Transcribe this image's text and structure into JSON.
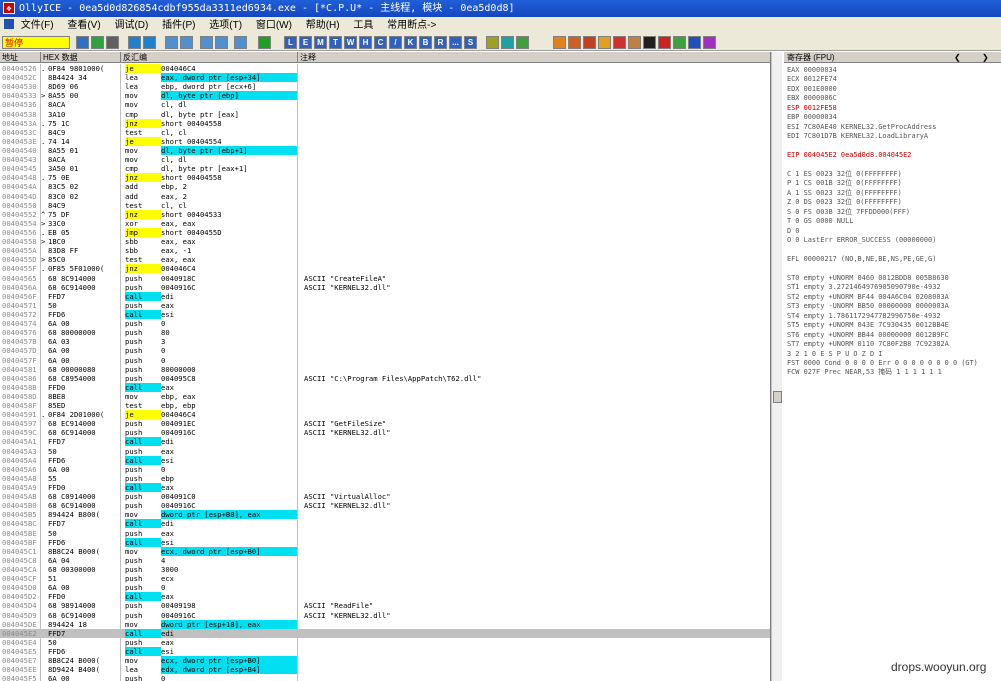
{
  "window": {
    "title": "OllyICE - 0ea5d0d826854cdbf955da3311ed6934.exe - [*C.P.U* - 主线程, 模块 - 0ea5d0d8]",
    "icon_glyph": "❖"
  },
  "menu": [
    "文件(F)",
    "查看(V)",
    "调试(D)",
    "插件(P)",
    "选项(T)",
    "窗口(W)",
    "帮助(H)",
    "工具",
    "常用断点->"
  ],
  "toolbar": {
    "status": "暂停",
    "letters": [
      "L",
      "E",
      "M",
      "T",
      "W",
      "H",
      "C",
      "/",
      "K",
      "B",
      "R",
      "...",
      "S"
    ]
  },
  "cpu": {
    "headers": {
      "address": "地址",
      "hex": "HEX 数据",
      "disasm": "反汇编",
      "comment": "注释"
    },
    "rows": [
      {
        "a": "00404526",
        "m": ".",
        "h": "0F84 9801000(",
        "mn": "je",
        "op": "004046C4",
        "cm": "",
        "mnc": "yel"
      },
      {
        "a": "0040452C",
        "m": "",
        "h": "8B4424 34",
        "mn": "lea",
        "op": "eax, dword ptr [esp+34]",
        "cm": "",
        "opc": "cyan"
      },
      {
        "a": "00404530",
        "m": "",
        "h": "8D69 06",
        "mn": "lea",
        "op": "ebp, dword ptr [ecx+6]",
        "cm": ""
      },
      {
        "a": "00404533",
        "m": ">",
        "h": "8A55 00",
        "mn": "mov",
        "op": "dl, byte ptr [ebp]",
        "cm": "",
        "opc": "cyan"
      },
      {
        "a": "00404536",
        "m": "",
        "h": "8ACA",
        "mn": "mov",
        "op": "cl, dl",
        "cm": ""
      },
      {
        "a": "00404538",
        "m": "",
        "h": "3A10",
        "mn": "cmp",
        "op": "dl, byte ptr [eax]",
        "cm": ""
      },
      {
        "a": "0040453A",
        "m": ".",
        "h": "75 1C",
        "mn": "jnz",
        "op": "short 00404558",
        "cm": "",
        "mnc": "yel"
      },
      {
        "a": "0040453C",
        "m": "",
        "h": "84C9",
        "mn": "test",
        "op": "cl, cl",
        "cm": ""
      },
      {
        "a": "0040453E",
        "m": ".",
        "h": "74 14",
        "mn": "je",
        "op": "short 00404554",
        "cm": "",
        "mnc": "yel"
      },
      {
        "a": "00404540",
        "m": "",
        "h": "8A55 01",
        "mn": "mov",
        "op": "dl, byte ptr [ebp+1]",
        "cm": "",
        "opc": "cyan"
      },
      {
        "a": "00404543",
        "m": "",
        "h": "8ACA",
        "mn": "mov",
        "op": "cl, dl",
        "cm": ""
      },
      {
        "a": "00404545",
        "m": "",
        "h": "3A50 01",
        "mn": "cmp",
        "op": "dl, byte ptr [eax+1]",
        "cm": ""
      },
      {
        "a": "00404548",
        "m": ".",
        "h": "75 0E",
        "mn": "jnz",
        "op": "short 00404558",
        "cm": "",
        "mnc": "yel"
      },
      {
        "a": "0040454A",
        "m": "",
        "h": "83C5 02",
        "mn": "add",
        "op": "ebp, 2",
        "cm": ""
      },
      {
        "a": "0040454D",
        "m": "",
        "h": "83C0 02",
        "mn": "add",
        "op": "eax, 2",
        "cm": ""
      },
      {
        "a": "00404550",
        "m": "",
        "h": "84C9",
        "mn": "test",
        "op": "cl, cl",
        "cm": ""
      },
      {
        "a": "00404552",
        "m": "^",
        "h": "75 DF",
        "mn": "jnz",
        "op": "short 00404533",
        "cm": "",
        "mnc": "yel"
      },
      {
        "a": "00404554",
        "m": ">",
        "h": "33C0",
        "mn": "xor",
        "op": "eax, eax",
        "cm": ""
      },
      {
        "a": "00404556",
        "m": ".",
        "h": "EB 05",
        "mn": "jmp",
        "op": "short 0040455D",
        "cm": "",
        "mnc": "yel"
      },
      {
        "a": "00404558",
        "m": ">",
        "h": "1BC0",
        "mn": "sbb",
        "op": "eax, eax",
        "cm": ""
      },
      {
        "a": "0040455A",
        "m": "",
        "h": "83D8 FF",
        "mn": "sbb",
        "op": "eax, -1",
        "cm": ""
      },
      {
        "a": "0040455D",
        "m": ">",
        "h": "85C0",
        "mn": "test",
        "op": "eax, eax",
        "cm": ""
      },
      {
        "a": "0040455F",
        "m": ".",
        "h": "0F85 5F01000(",
        "mn": "jnz",
        "op": "004046C4",
        "cm": "",
        "mnc": "yel"
      },
      {
        "a": "00404565",
        "m": "",
        "h": "68 8C914000",
        "mn": "push",
        "op": "0040918C",
        "cm": "ASCII \"CreateFileA\""
      },
      {
        "a": "0040456A",
        "m": "",
        "h": "68 6C914000",
        "mn": "push",
        "op": "0040916C",
        "cm": "ASCII \"KERNEL32.dll\""
      },
      {
        "a": "0040456F",
        "m": "",
        "h": "FFD7",
        "mn": "call",
        "op": "edi",
        "cm": "",
        "mnc": "cyan"
      },
      {
        "a": "00404571",
        "m": "",
        "h": "50",
        "mn": "push",
        "op": "eax",
        "cm": ""
      },
      {
        "a": "00404572",
        "m": "",
        "h": "FFD6",
        "mn": "call",
        "op": "esi",
        "cm": "",
        "mnc": "cyan"
      },
      {
        "a": "00404574",
        "m": "",
        "h": "6A 00",
        "mn": "push",
        "op": "0",
        "cm": ""
      },
      {
        "a": "00404576",
        "m": "",
        "h": "68 80000000",
        "mn": "push",
        "op": "80",
        "cm": ""
      },
      {
        "a": "0040457B",
        "m": "",
        "h": "6A 03",
        "mn": "push",
        "op": "3",
        "cm": ""
      },
      {
        "a": "0040457D",
        "m": "",
        "h": "6A 00",
        "mn": "push",
        "op": "0",
        "cm": ""
      },
      {
        "a": "0040457F",
        "m": "",
        "h": "6A 00",
        "mn": "push",
        "op": "0",
        "cm": ""
      },
      {
        "a": "00404581",
        "m": "",
        "h": "68 00000080",
        "mn": "push",
        "op": "80000000",
        "cm": ""
      },
      {
        "a": "00404586",
        "m": "",
        "h": "68 C8954000",
        "mn": "push",
        "op": "004095C8",
        "cm": "ASCII \"C:\\Program Files\\AppPatch\\T62.dll\""
      },
      {
        "a": "0040458B",
        "m": "",
        "h": "FFD0",
        "mn": "call",
        "op": "eax",
        "cm": "",
        "mnc": "cyan"
      },
      {
        "a": "0040458D",
        "m": "",
        "h": "8BE8",
        "mn": "mov",
        "op": "ebp, eax",
        "cm": ""
      },
      {
        "a": "0040458F",
        "m": "",
        "h": "85ED",
        "mn": "test",
        "op": "ebp, ebp",
        "cm": ""
      },
      {
        "a": "00404591",
        "m": ".",
        "h": "0F84 2D01000(",
        "mn": "je",
        "op": "004046C4",
        "cm": "",
        "mnc": "yel"
      },
      {
        "a": "00404597",
        "m": "",
        "h": "68 EC914000",
        "mn": "push",
        "op": "004091EC",
        "cm": "ASCII \"GetFileSize\""
      },
      {
        "a": "0040459C",
        "m": "",
        "h": "68 6C914000",
        "mn": "push",
        "op": "0040916C",
        "cm": "ASCII \"KERNEL32.dll\""
      },
      {
        "a": "004045A1",
        "m": "",
        "h": "FFD7",
        "mn": "call",
        "op": "edi",
        "cm": "",
        "mnc": "cyan"
      },
      {
        "a": "004045A3",
        "m": "",
        "h": "50",
        "mn": "push",
        "op": "eax",
        "cm": ""
      },
      {
        "a": "004045A4",
        "m": "",
        "h": "FFD6",
        "mn": "call",
        "op": "esi",
        "cm": "",
        "mnc": "cyan"
      },
      {
        "a": "004045A6",
        "m": "",
        "h": "6A 00",
        "mn": "push",
        "op": "0",
        "cm": ""
      },
      {
        "a": "004045A8",
        "m": "",
        "h": "55",
        "mn": "push",
        "op": "ebp",
        "cm": ""
      },
      {
        "a": "004045A9",
        "m": "",
        "h": "FFD0",
        "mn": "call",
        "op": "eax",
        "cm": "",
        "mnc": "cyan"
      },
      {
        "a": "004045AB",
        "m": "",
        "h": "68 C0914000",
        "mn": "push",
        "op": "004091C0",
        "cm": "ASCII \"VirtualAlloc\""
      },
      {
        "a": "004045B0",
        "m": "",
        "h": "68 6C914000",
        "mn": "push",
        "op": "0040916C",
        "cm": "ASCII \"KERNEL32.dll\""
      },
      {
        "a": "004045B5",
        "m": "",
        "h": "894424 B800(",
        "mn": "mov",
        "op": "dword ptr [esp+B8], eax",
        "cm": "",
        "opc": "cyan"
      },
      {
        "a": "004045BC",
        "m": "",
        "h": "FFD7",
        "mn": "call",
        "op": "edi",
        "cm": "",
        "mnc": "cyan"
      },
      {
        "a": "004045BE",
        "m": "",
        "h": "50",
        "mn": "push",
        "op": "eax",
        "cm": ""
      },
      {
        "a": "004045BF",
        "m": "",
        "h": "FFD6",
        "mn": "call",
        "op": "esi",
        "cm": "",
        "mnc": "cyan"
      },
      {
        "a": "004045C1",
        "m": "",
        "h": "8B8C24 B000(",
        "mn": "mov",
        "op": "ecx, dword ptr [esp+B0]",
        "cm": "",
        "opc": "cyan"
      },
      {
        "a": "004045C8",
        "m": "",
        "h": "6A 04",
        "mn": "push",
        "op": "4",
        "cm": ""
      },
      {
        "a": "004045CA",
        "m": "",
        "h": "68 00300000",
        "mn": "push",
        "op": "3000",
        "cm": ""
      },
      {
        "a": "004045CF",
        "m": "",
        "h": "51",
        "mn": "push",
        "op": "ecx",
        "cm": ""
      },
      {
        "a": "004045D0",
        "m": "",
        "h": "6A 00",
        "mn": "push",
        "op": "0",
        "cm": ""
      },
      {
        "a": "004045D2",
        "m": "",
        "h": "FFD0",
        "mn": "call",
        "op": "eax",
        "cm": "",
        "mnc": "cyan"
      },
      {
        "a": "004045D4",
        "m": "",
        "h": "68 98914000",
        "mn": "push",
        "op": "00409198",
        "cm": "ASCII \"ReadFile\""
      },
      {
        "a": "004045D9",
        "m": "",
        "h": "68 6C914000",
        "mn": "push",
        "op": "0040916C",
        "cm": "ASCII \"KERNEL32.dll\""
      },
      {
        "a": "004045DE",
        "m": "",
        "h": "894424 18",
        "mn": "mov",
        "op": "dword ptr [esp+18], eax",
        "cm": "",
        "opc": "cyan"
      },
      {
        "a": "004045E2",
        "m": "",
        "h": "FFD7",
        "mn": "call",
        "op": "edi",
        "cm": "",
        "mnc": "cyan",
        "sel": true
      },
      {
        "a": "004045E4",
        "m": "",
        "h": "50",
        "mn": "push",
        "op": "eax",
        "cm": ""
      },
      {
        "a": "004045E5",
        "m": "",
        "h": "FFD6",
        "mn": "call",
        "op": "esi",
        "cm": "",
        "mnc": "cyan"
      },
      {
        "a": "004045E7",
        "m": "",
        "h": "8B8C24 B000(",
        "mn": "mov",
        "op": "ecx, dword ptr [esp+B0]",
        "cm": "",
        "opc": "cyan"
      },
      {
        "a": "004045EE",
        "m": "",
        "h": "8D9424 B400(",
        "mn": "lea",
        "op": "edx, dword ptr [esp+B4]",
        "cm": "",
        "opc": "cyan"
      },
      {
        "a": "004045F5",
        "m": "",
        "h": "6A 00",
        "mn": "push",
        "op": "0",
        "cm": ""
      }
    ]
  },
  "registers": {
    "header": "寄存器 (FPU)",
    "lines": [
      {
        "t": "EAX 00000034",
        "c": ""
      },
      {
        "t": "ECX 0012FE74",
        "c": ""
      },
      {
        "t": "EDX 001E0000",
        "c": ""
      },
      {
        "t": "EBX 0000006C",
        "c": ""
      },
      {
        "t": "ESP 0012FE58",
        "c": "red"
      },
      {
        "t": "EBP 00000034",
        "c": ""
      },
      {
        "t": "ESI 7C80AE40 KERNEL32.GetProcAddress",
        "c": ""
      },
      {
        "t": "EDI 7C801D7B KERNEL32.LoadLibraryA",
        "c": ""
      },
      {
        "t": "",
        "c": ""
      },
      {
        "t": "EIP 004045E2 0ea5d0d8.004045E2",
        "c": "red"
      },
      {
        "t": "",
        "c": ""
      },
      {
        "t": "C 1  ES 0023 32位 0(FFFFFFFF)",
        "c": ""
      },
      {
        "t": "P 1  CS 001B 32位 0(FFFFFFFF)",
        "c": ""
      },
      {
        "t": "A 1  SS 0023 32位 0(FFFFFFFF)",
        "c": ""
      },
      {
        "t": "Z 0  DS 0023 32位 0(FFFFFFFF)",
        "c": ""
      },
      {
        "t": "S 0  FS 003B 32位 7FFDD000(FFF)",
        "c": ""
      },
      {
        "t": "T 0  GS 0000 NULL",
        "c": ""
      },
      {
        "t": "D 0",
        "c": ""
      },
      {
        "t": "O 0  LastErr ERROR_SUCCESS (00000000)",
        "c": ""
      },
      {
        "t": "",
        "c": ""
      },
      {
        "t": "EFL 00000217 (NO,B,NE,BE,NS,PE,GE,G)",
        "c": ""
      },
      {
        "t": "",
        "c": ""
      },
      {
        "t": "ST0 empty +UNORM 0460 0012BDD8 005B8630",
        "c": ""
      },
      {
        "t": "ST1 empty 3.2721464976905090790e-4932",
        "c": ""
      },
      {
        "t": "ST2 empty +UNORM BF44 004A6C04 0208003A",
        "c": ""
      },
      {
        "t": "ST3 empty -UNORM BB50 00000000 0000003A",
        "c": ""
      },
      {
        "t": "ST4 empty 1.7861172947782996750e-4932",
        "c": ""
      },
      {
        "t": "ST5 empty +UNORM 043E 7C930435 0012BB4E",
        "c": ""
      },
      {
        "t": "ST6 empty +UNORM BB44 00000000 0012B9FC",
        "c": ""
      },
      {
        "t": "ST7 empty +UNORM 0110 7C80F2B8 7C92382A",
        "c": ""
      },
      {
        "t": "               3 2 1 0      E S P U O Z D I",
        "c": ""
      },
      {
        "t": "FST 0000  Cond 0 0 0 0  Err 0 0 0 0 0 0 0 0  (GT)",
        "c": ""
      },
      {
        "t": "FCW 027F  Prec NEAR,53  掩码    1 1 1 1 1 1",
        "c": ""
      }
    ]
  },
  "watermark": "drops.wooyun.org"
}
